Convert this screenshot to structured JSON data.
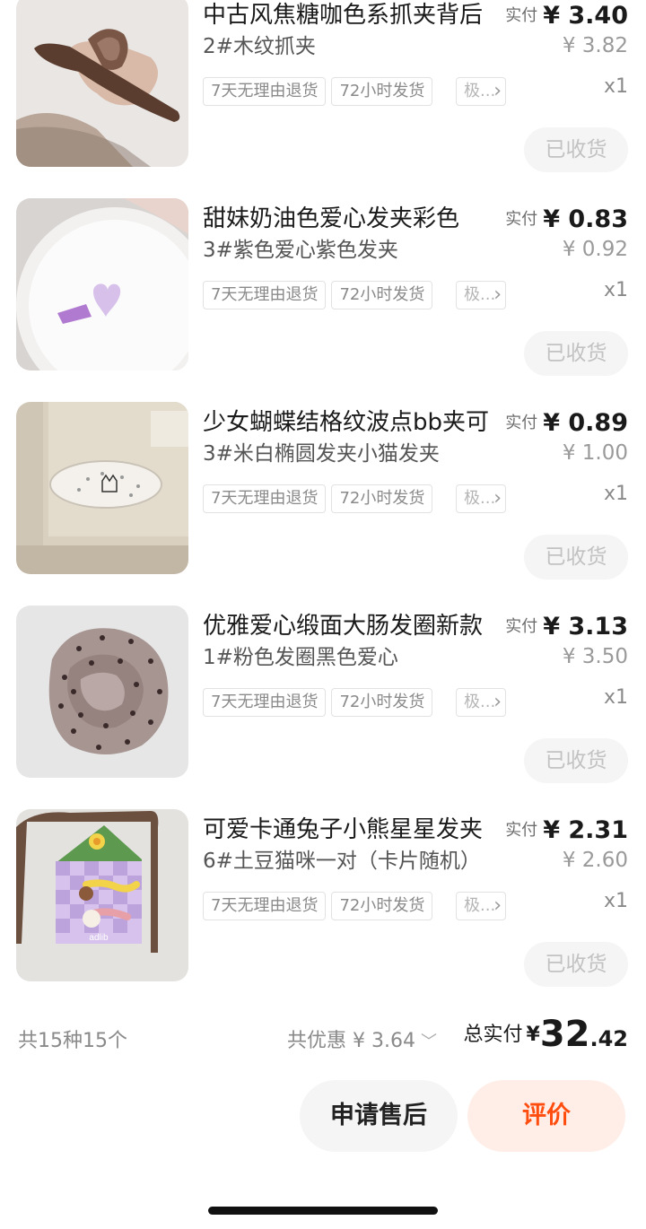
{
  "items": [
    {
      "title": "中古风焦糖咖色系抓夹背后",
      "sku": "2#木纹抓夹",
      "tags": [
        "7天无理由退货",
        "72小时发货"
      ],
      "tag_more": "极...",
      "paid_label": "实付",
      "paid_price": "¥ 3.40",
      "original_price": "¥ 3.82",
      "quantity": "x1",
      "status_button": "已收货",
      "image_icon": "hair-claw-image"
    },
    {
      "title": "甜妹奶油色爱心发夹彩色",
      "sku": "3#紫色爱心紫色发夹",
      "tags": [
        "7天无理由退货",
        "72小时发货"
      ],
      "tag_more": "极...",
      "paid_label": "实付",
      "paid_price": "¥ 0.83",
      "original_price": "¥ 0.92",
      "quantity": "x1",
      "status_button": "已收货",
      "image_icon": "heart-clip-image"
    },
    {
      "title": "少女蝴蝶结格纹波点bb夹可",
      "sku": "3#米白椭圆发夹小猫发夹",
      "tags": [
        "7天无理由退货",
        "72小时发货"
      ],
      "tag_more": "极...",
      "paid_label": "实付",
      "paid_price": "¥ 0.89",
      "original_price": "¥ 1.00",
      "quantity": "x1",
      "status_button": "已收货",
      "image_icon": "oval-cat-clip-image"
    },
    {
      "title": "优雅爱心缎面大肠发圈新款",
      "sku": "1#粉色发圈黑色爱心",
      "tags": [
        "7天无理由退货",
        "72小时发货"
      ],
      "tag_more": "极...",
      "paid_label": "实付",
      "paid_price": "¥ 3.13",
      "original_price": "¥ 3.50",
      "quantity": "x1",
      "status_button": "已收货",
      "image_icon": "scrunchie-image"
    },
    {
      "title": "可爱卡通兔子小熊星星发夹",
      "sku": "6#土豆猫咪一对（卡片随机）",
      "tags": [
        "7天无理由退货",
        "72小时发货"
      ],
      "tag_more": "极...",
      "paid_label": "实付",
      "paid_price": "¥ 2.31",
      "original_price": "¥ 2.60",
      "quantity": "x1",
      "status_button": "已收货",
      "image_icon": "cartoon-clips-card-image",
      "image_card_text": "adlib"
    }
  ],
  "summary": {
    "total_count": "共15种15个",
    "discount": "共优惠 ¥ 3.64",
    "total_label": "总实付",
    "total_yen": "¥",
    "total_integer": "32",
    "total_decimal": ".42"
  },
  "actions": {
    "after_sale": "申请售后",
    "review": "评价"
  },
  "colors": {
    "accent": "#ff4d0f",
    "review_bg": "#ffeee8",
    "button_bg": "#f5f5f5"
  }
}
